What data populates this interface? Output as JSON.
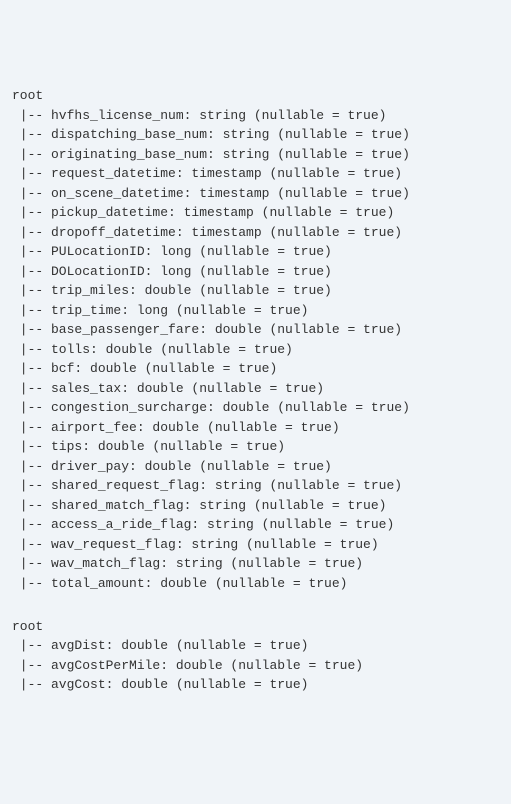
{
  "schemas": [
    {
      "root_label": "root",
      "fields": [
        {
          "name": "hvfhs_license_num",
          "type": "string",
          "nullable": true
        },
        {
          "name": "dispatching_base_num",
          "type": "string",
          "nullable": true
        },
        {
          "name": "originating_base_num",
          "type": "string",
          "nullable": true
        },
        {
          "name": "request_datetime",
          "type": "timestamp",
          "nullable": true
        },
        {
          "name": "on_scene_datetime",
          "type": "timestamp",
          "nullable": true
        },
        {
          "name": "pickup_datetime",
          "type": "timestamp",
          "nullable": true
        },
        {
          "name": "dropoff_datetime",
          "type": "timestamp",
          "nullable": true
        },
        {
          "name": "PULocationID",
          "type": "long",
          "nullable": true
        },
        {
          "name": "DOLocationID",
          "type": "long",
          "nullable": true
        },
        {
          "name": "trip_miles",
          "type": "double",
          "nullable": true
        },
        {
          "name": "trip_time",
          "type": "long",
          "nullable": true
        },
        {
          "name": "base_passenger_fare",
          "type": "double",
          "nullable": true
        },
        {
          "name": "tolls",
          "type": "double",
          "nullable": true
        },
        {
          "name": "bcf",
          "type": "double",
          "nullable": true
        },
        {
          "name": "sales_tax",
          "type": "double",
          "nullable": true
        },
        {
          "name": "congestion_surcharge",
          "type": "double",
          "nullable": true
        },
        {
          "name": "airport_fee",
          "type": "double",
          "nullable": true
        },
        {
          "name": "tips",
          "type": "double",
          "nullable": true
        },
        {
          "name": "driver_pay",
          "type": "double",
          "nullable": true
        },
        {
          "name": "shared_request_flag",
          "type": "string",
          "nullable": true
        },
        {
          "name": "shared_match_flag",
          "type": "string",
          "nullable": true
        },
        {
          "name": "access_a_ride_flag",
          "type": "string",
          "nullable": true
        },
        {
          "name": "wav_request_flag",
          "type": "string",
          "nullable": true
        },
        {
          "name": "wav_match_flag",
          "type": "string",
          "nullable": true
        },
        {
          "name": "total_amount",
          "type": "double",
          "nullable": true
        }
      ]
    },
    {
      "root_label": "root",
      "fields": [
        {
          "name": "avgDist",
          "type": "double",
          "nullable": true
        },
        {
          "name": "avgCostPerMile",
          "type": "double",
          "nullable": true
        },
        {
          "name": "avgCost",
          "type": "double",
          "nullable": true
        }
      ]
    }
  ],
  "tree_prefix": " |-- ",
  "nullable_true_text": "(nullable = true)",
  "blank_line": ""
}
